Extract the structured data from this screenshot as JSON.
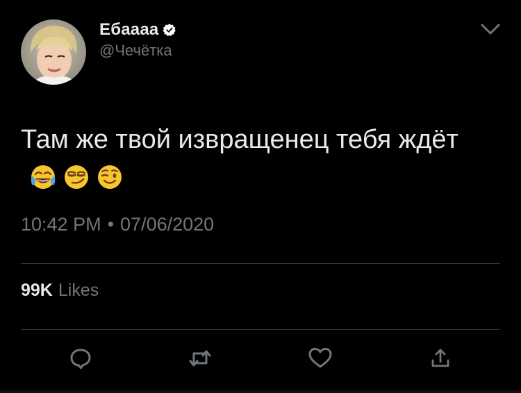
{
  "author": {
    "display_name": "Ебаааа",
    "handle": "@Чечётка",
    "verified": true,
    "avatar_icon": "profile-photo-avatar"
  },
  "tweet": {
    "text": "Там же твой извращенец тебя ждёт",
    "emojis": [
      "face-with-tears-of-joy",
      "smirking-face",
      "winking-face"
    ],
    "time": "10:42 PM",
    "separator": "•",
    "date": "07/06/2020"
  },
  "stats": {
    "likes_count": "99K",
    "likes_label": "Likes"
  },
  "actions": [
    {
      "icon": "reply-icon"
    },
    {
      "icon": "retweet-icon"
    },
    {
      "icon": "like-icon"
    },
    {
      "icon": "share-icon"
    }
  ],
  "colors": {
    "background": "#000000",
    "text_primary": "#e7e9ea",
    "text_secondary": "#71767b",
    "divider": "#2f3336"
  }
}
